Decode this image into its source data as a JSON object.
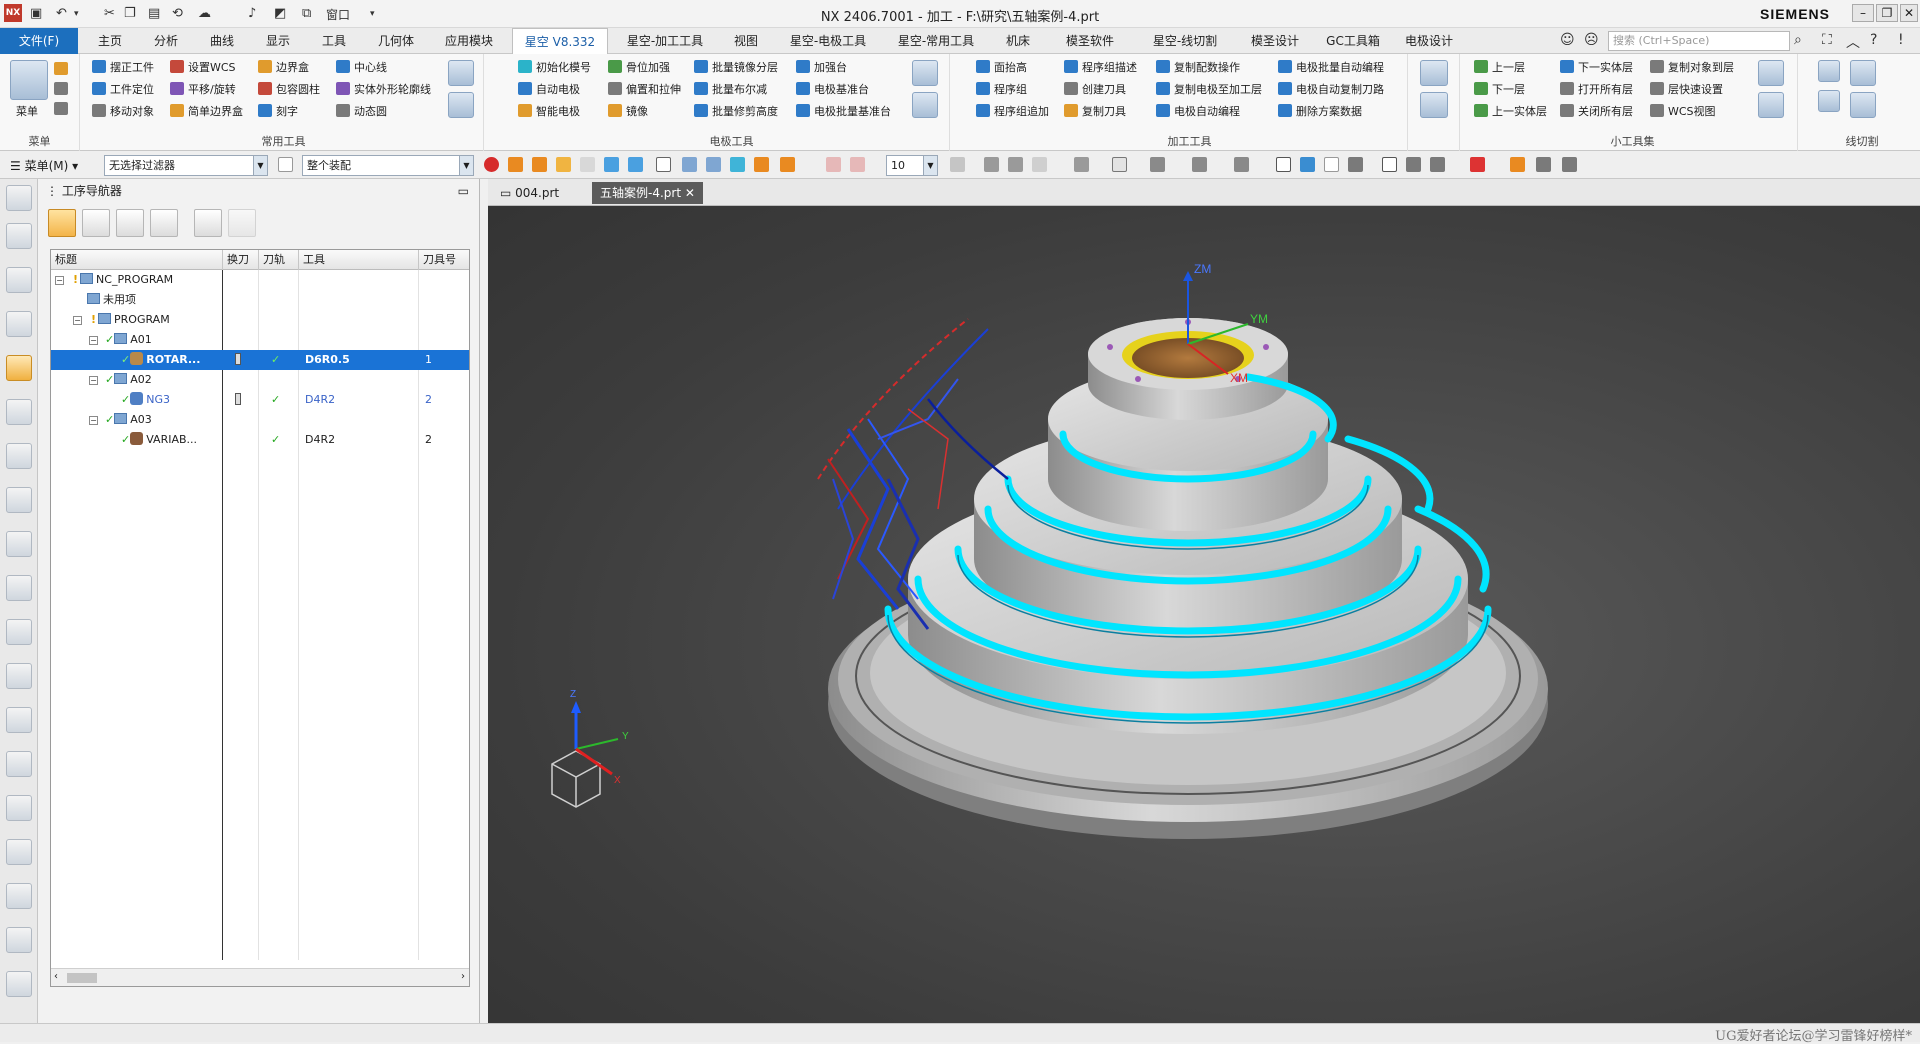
{
  "titlebar": {
    "logo": "NX",
    "title": "NX 2406.7001 - 加工 - F:\\研究\\五轴案例-4.prt",
    "brand": "SIEMENS",
    "window_menu": "窗口"
  },
  "tabs": {
    "file": "文件(F)",
    "items": [
      "主页",
      "分析",
      "曲线",
      "显示",
      "工具",
      "几何体",
      "应用模块",
      "星空 V8.332",
      "星空-加工工具",
      "视图",
      "星空-电极工具",
      "星空-常用工具",
      "机床",
      "模圣软件",
      "星空-线切割",
      "模圣设计",
      "GC工具箱",
      "电极设计"
    ],
    "search_placeholder": "搜索 (Ctrl+Space)"
  },
  "ribbon": {
    "menu_group": {
      "label": "菜单",
      "name": "菜单"
    },
    "common": {
      "name": "常用工具",
      "items": [
        "摆正工件",
        "设置WCS",
        "边界盒",
        "中心线",
        "工件定位",
        "平移/旋转",
        "包容圆柱",
        "实体外形轮廓线",
        "移动对象",
        "简单边界盒",
        "刻字",
        "动态圆"
      ]
    },
    "electrode": {
      "name": "电极工具",
      "items": [
        "初始化模号",
        "骨位加强",
        "批量镜像分层",
        "加强台",
        "自动电极",
        "偏置和拉伸",
        "批量布尔减",
        "电极基准台",
        "智能电极",
        "镜像",
        "批量修剪高度",
        "电极批量基准台"
      ]
    },
    "machining": {
      "name": "加工工具",
      "items": [
        "面抬高",
        "程序组描述",
        "复制配数操作",
        "电极批量自动编程",
        "程序组",
        "创建刀具",
        "复制电极至加工层",
        "电极自动复制刀路",
        "程序组追加",
        "复制刀具",
        "电极自动编程",
        "删除方案数据"
      ]
    },
    "small": {
      "name": "小工具集",
      "items": [
        "上一层",
        "下一实体层",
        "复制对象到层",
        "下一层",
        "打开所有层",
        "层快速设置",
        "上一实体层",
        "关闭所有层",
        "WCS视图"
      ]
    },
    "wire": {
      "name": "线切割"
    }
  },
  "cmdbar": {
    "menu_label": "菜单(M)",
    "filter": "无选择过滤器",
    "assembly": "整个装配",
    "number": "10"
  },
  "navigator": {
    "title": "工序导航器",
    "columns": [
      "标题",
      "换刀",
      "刀轨",
      "工具",
      "刀具号"
    ],
    "rows": [
      {
        "name": "NC_PROGRAM",
        "change": "",
        "path": "",
        "tool": "",
        "num": ""
      },
      {
        "name": "未用项",
        "change": "",
        "path": "",
        "tool": "",
        "num": ""
      },
      {
        "name": "PROGRAM",
        "change": "",
        "path": "",
        "tool": "",
        "num": ""
      },
      {
        "name": "A01",
        "change": "",
        "path": "",
        "tool": "",
        "num": ""
      },
      {
        "name": "ROTAR...",
        "change": "",
        "path": "✓",
        "tool": "D6R0.5",
        "num": "1"
      },
      {
        "name": "A02",
        "change": "",
        "path": "",
        "tool": "",
        "num": ""
      },
      {
        "name": "NG3",
        "change": "",
        "path": "✓",
        "tool": "D4R2",
        "num": "2"
      },
      {
        "name": "A03",
        "change": "",
        "path": "",
        "tool": "",
        "num": ""
      },
      {
        "name": "VARIAB...",
        "change": "",
        "path": "✓",
        "tool": "D4R2",
        "num": "2"
      }
    ]
  },
  "doctabs": [
    "004.prt",
    "五轴案例-4.prt"
  ],
  "viewport": {
    "axes": {
      "zm": "ZM",
      "ym": "YM",
      "xm": "XM"
    },
    "triad": {
      "z": "Z",
      "y": "Y",
      "x": "X"
    }
  },
  "status": {
    "watermark": "UG爱好者论坛@学习雷锋好榜样*"
  },
  "colors": {
    "accent": "#1c6fbe",
    "toolpath": "#00e5ff",
    "selection": "#1a73d6"
  }
}
